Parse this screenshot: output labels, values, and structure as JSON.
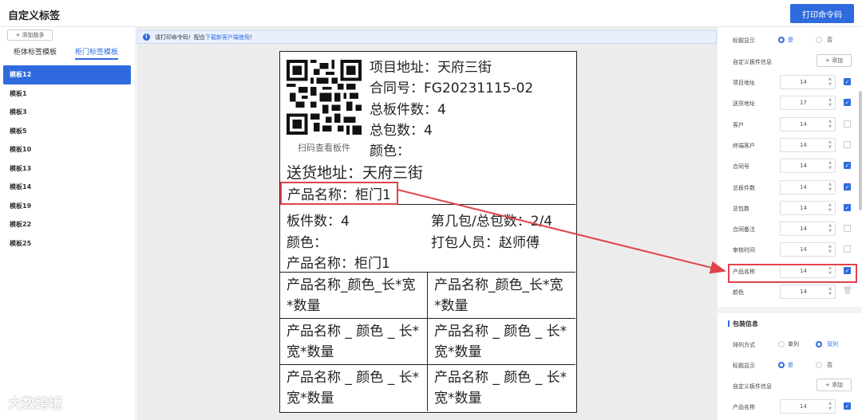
{
  "header": {
    "title": "自定义标签",
    "print_button": "打印命令码"
  },
  "sidebar": {
    "add_template": "+ 添加版多",
    "tabs": [
      "柜体标签模板",
      "柜门标签模板"
    ],
    "templates": [
      "模板12",
      "模板1",
      "模板3",
      "模板5",
      "模板10",
      "模板13",
      "模板14",
      "模板19",
      "模板22",
      "模板25"
    ]
  },
  "notice": {
    "text": "请打印命令码！配合",
    "link": "下载新客户端使用",
    "end": "！"
  },
  "label": {
    "project_address": "项目地址：天府三街",
    "contract_no": "合同号：FG20231115-02",
    "total_boards": "总板件数：4",
    "total_packages": "总包数：4",
    "scan_text": "扫码查看板件",
    "color": "颜色：",
    "delivery_address": "送货地址：天府三街",
    "product_name": "产品名称：柜门1",
    "section2": {
      "board_count": "板件数：4",
      "package_no": "第几包/总包数：2/4",
      "color": "颜色：",
      "packer": "打包人员：赵师傅",
      "product_name": "产品名称：柜门1"
    },
    "grid": [
      [
        "产品名称_颜色_长*宽",
        "*数量"
      ],
      [
        "产品名称_颜色_长*宽",
        "*数量"
      ],
      [
        "产品名称 _ 颜色 _ 长*",
        "宽*数量"
      ],
      [
        "产品名称 _ 颜色 _ 长*",
        "宽*数量"
      ],
      [
        "产品名称 _ 颜色 _ 长*",
        "宽*数量"
      ],
      [
        "产品名称 _ 颜色 _ 长*",
        "宽*数量"
      ]
    ]
  },
  "panel": {
    "title_display": {
      "label": "标题显示",
      "yes": "是",
      "no": "否"
    },
    "custom_board_info": {
      "label": "自定义板件信息",
      "add": "+ 添加"
    },
    "fields": [
      {
        "label": "项目地址",
        "size": "14",
        "checked": true
      },
      {
        "label": "送货地址",
        "size": "17",
        "checked": true
      },
      {
        "label": "客户",
        "size": "14",
        "checked": false
      },
      {
        "label": "终端客户",
        "size": "14",
        "checked": false
      },
      {
        "label": "合同号",
        "size": "14",
        "checked": true
      },
      {
        "label": "总板件数",
        "size": "14",
        "checked": true
      },
      {
        "label": "总包数",
        "size": "14",
        "checked": true
      },
      {
        "label": "合同备注",
        "size": "14",
        "checked": false
      },
      {
        "label": "审核时间",
        "size": "14",
        "checked": false
      },
      {
        "label": "产品名称",
        "size": "14",
        "checked": true
      },
      {
        "label": "颜色",
        "size": "14",
        "checked": false
      }
    ],
    "package_info": "包装信息",
    "arrangement": {
      "label": "排列方式",
      "single": "单列",
      "double": "双列"
    },
    "title_display2": {
      "label": "标题显示",
      "yes": "是",
      "no": "否"
    },
    "custom_board_info2": {
      "label": "自定义板件信息",
      "add": "+ 添加"
    },
    "last_field": {
      "label": "产品名称",
      "size": "14",
      "checked": true
    }
  },
  "watermark": "大数跨境",
  "colors": {
    "accent": "#2f6bde",
    "highlight": "#e0444a"
  }
}
